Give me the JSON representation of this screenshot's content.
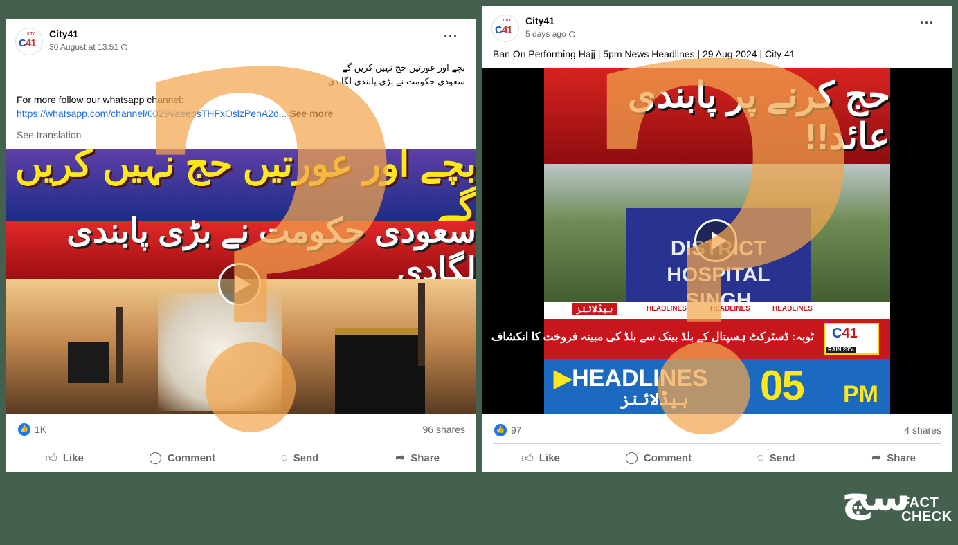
{
  "posts": [
    {
      "page_name": "City41",
      "timestamp": "30 August at 13:51",
      "urdu_line1": "بچے اور عورتیں حج نہیں کریں گے",
      "urdu_line2": "سعودی حکومت نے بڑی پابندی لگا دی",
      "follow_text": "For more follow our whatsapp channel:",
      "link": "https://whatsapp.com/channel/0029VaeebsTHFxOslzPenA2d...",
      "see_more": "See more",
      "see_translation": "See translation",
      "thumb_line1": "بچے اور عورتیں حج نہیں کریں گے",
      "thumb_line2": "سعودی حکومت نے بڑی پابندی لگادی",
      "likes": "1K",
      "shares": "96 shares",
      "actions": [
        "Like",
        "Comment",
        "Send",
        "Share"
      ]
    },
    {
      "page_name": "City41",
      "timestamp": "5 days ago",
      "caption": "Ban On Performing Hajj | 5pm News Headlines | 29 Aug 2024 | City 41",
      "thumb_title": "حج کرنے پر پابندی عائد!!",
      "sign_text": "DISTRICT HOSPITAL\nSINGH",
      "ticker_label": "ہیڈلائنز",
      "ticker_repeat": "HEADLINES",
      "ticker_text": "ٹوبہ: ڈسٹرکٹ ہسپتال کے بلڈ بینک سے بلڈ کی مبینہ فروخت کا انکشاف",
      "rain_text": "RAIN 28°c",
      "headlines_word": "HEADLINES",
      "headlines_urdu": "ہیڈلائنز",
      "time_big": "05",
      "time_pm": "PM",
      "likes": "97",
      "shares": "4 shares",
      "actions": [
        "Like",
        "Comment",
        "Send",
        "Share"
      ]
    }
  ],
  "logo": {
    "small": "CITY",
    "num": "41",
    "prefix": "C"
  },
  "overlay_glyph": "?",
  "badge": {
    "glyph": "سچ",
    "line1": "FACT",
    "line2": "CHECK"
  },
  "colors": {
    "bg": "#44604f",
    "link": "#216fdb",
    "accent_red": "#c8161d",
    "accent_yellow": "#ffe81a",
    "fb_blue": "#1877f2",
    "qmark": "#f3a54e"
  }
}
